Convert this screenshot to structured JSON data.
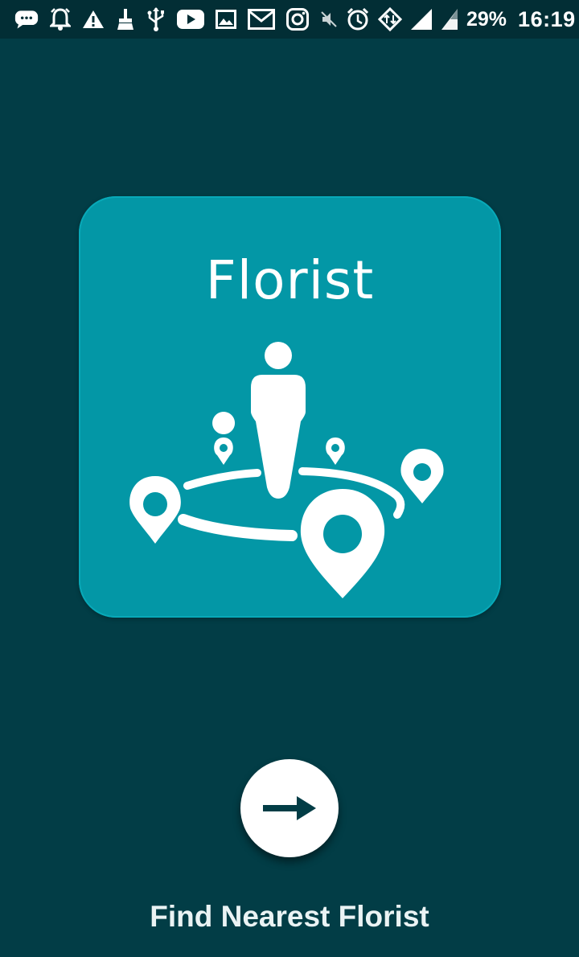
{
  "status_bar": {
    "left_icons": [
      "chat-bubble-icon",
      "alarm-bell-icon",
      "warning-icon",
      "cleaner-brush-icon",
      "usb-icon",
      "youtube-icon",
      "gallery-icon",
      "email-icon",
      "instagram-icon"
    ],
    "right_icons": [
      "mute-icon",
      "alarm-clock-icon",
      "data-transfer-icon",
      "signal-icon",
      "signal-icon-2"
    ],
    "battery_percent": "29%",
    "time": "16:19",
    "battery_color": "#36c94a"
  },
  "logo": {
    "title": "Florist",
    "card_color": "#0397a6",
    "icon": "person-with-map-pins-icon"
  },
  "next_button": {
    "icon": "arrow-right-icon"
  },
  "caption": "Find Nearest Florist",
  "colors": {
    "background": "#023d46",
    "status_bar": "#022e35",
    "accent": "#0397a6"
  }
}
